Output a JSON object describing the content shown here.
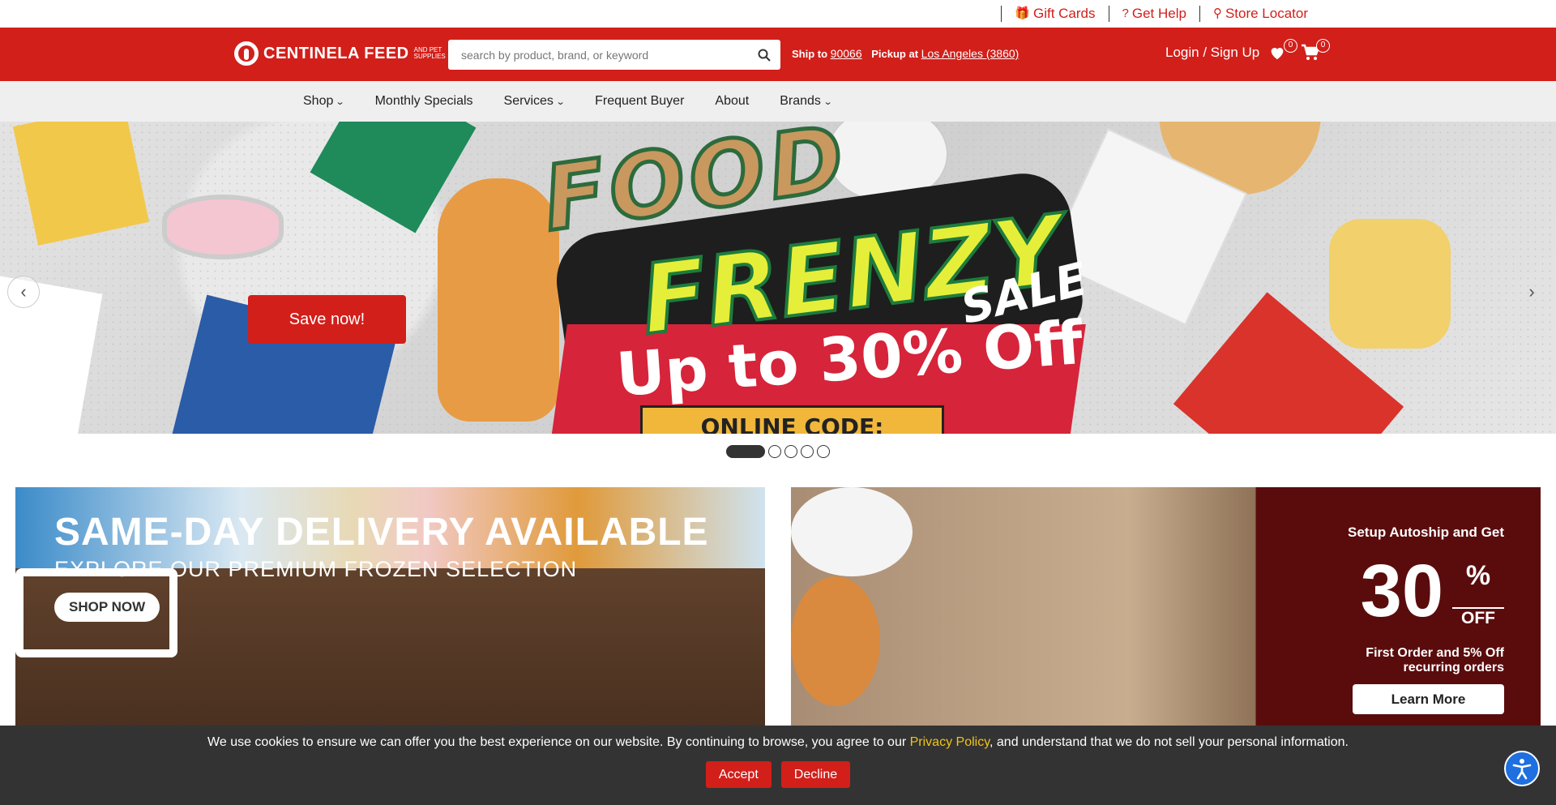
{
  "utility": {
    "gift_cards": "Gift Cards",
    "get_help": "Get Help",
    "store_locator": "Store Locator"
  },
  "header": {
    "logo_text": "CENTINELA FEED",
    "logo_sub": "AND PET SUPPLIES",
    "search_placeholder": "search by product, brand, or keyword",
    "ship_to_label": "Ship to",
    "ship_to_zip": "90066",
    "pickup_label": "Pickup at",
    "pickup_store": "Los Angeles (3860)",
    "login": "Login / Sign Up",
    "wishlist_count": "0",
    "cart_count": "0"
  },
  "nav": {
    "items": [
      {
        "label": "Shop",
        "dropdown": true
      },
      {
        "label": "Monthly Specials",
        "dropdown": false
      },
      {
        "label": "Services",
        "dropdown": true
      },
      {
        "label": "Frequent Buyer",
        "dropdown": false
      },
      {
        "label": "About",
        "dropdown": false
      },
      {
        "label": "Brands",
        "dropdown": true
      }
    ]
  },
  "hero": {
    "headline_1": "FOOD",
    "headline_2": "FRENZY",
    "headline_tag": "SALE",
    "offer": "Up to 30% Off",
    "code": "ONLINE CODE: FRENZYSEP",
    "cta": "Save now!",
    "slide_count": 5,
    "active_slide": 1
  },
  "promos": {
    "left": {
      "title": "SAME-DAY DELIVERY AVAILABLE",
      "subtitle": "EXPLORE OUR PREMIUM FROZEN SELECTION",
      "cta": "SHOP NOW"
    },
    "right": {
      "line1": "Setup Autoship and Get",
      "big": "30",
      "pct": "%",
      "off": "OFF",
      "line2": "First Order and 5% Off recurring orders",
      "cta": "Learn More"
    }
  },
  "cookie": {
    "text_before": "We use cookies to ensure we can offer you the best experience on our website. By continuing to browse, you agree to our ",
    "privacy": "Privacy Policy",
    "text_after": ", and understand that we do not sell your personal information.",
    "accept": "Accept",
    "decline": "Decline"
  },
  "colors": {
    "brand_red": "#d21f1a",
    "nav_bg": "#efefef",
    "cookie_bg": "#333333",
    "privacy_link": "#f0c419",
    "a11y_blue": "#1e6fe0"
  }
}
